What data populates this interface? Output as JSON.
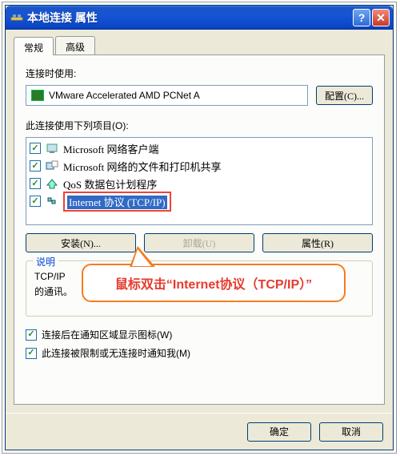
{
  "window": {
    "title": "本地连接 属性"
  },
  "tabs": {
    "general": "常规",
    "advanced": "高级"
  },
  "labels": {
    "connect_using": "连接时使用:",
    "adapter": "VMware Accelerated AMD PCNet A",
    "configure": "配置(C)...",
    "items_label": "此连接使用下列项目(O):",
    "install": "安装(N)...",
    "uninstall": "卸载(U)",
    "properties": "属性(R)",
    "group_title": "说明",
    "desc_line1": "TCP/IP ",
    "desc_line2": "的通讯。",
    "show_icon": "连接后在通知区域显示图标(W)",
    "notify": "此连接被限制或无连接时通知我(M)",
    "ok": "确定",
    "cancel": "取消"
  },
  "list": [
    {
      "checked": true,
      "icon": "client-icon",
      "text": "Microsoft 网络客户端"
    },
    {
      "checked": true,
      "icon": "share-icon",
      "text": "Microsoft 网络的文件和打印机共享"
    },
    {
      "checked": true,
      "icon": "qos-icon",
      "text": "QoS 数据包计划程序"
    },
    {
      "checked": true,
      "icon": "protocol-icon",
      "text": "Internet 协议 (TCP/IP)",
      "selected": true
    }
  ],
  "callout": {
    "text": "鼠标双击“Internet协议（TCP/IP）”"
  }
}
